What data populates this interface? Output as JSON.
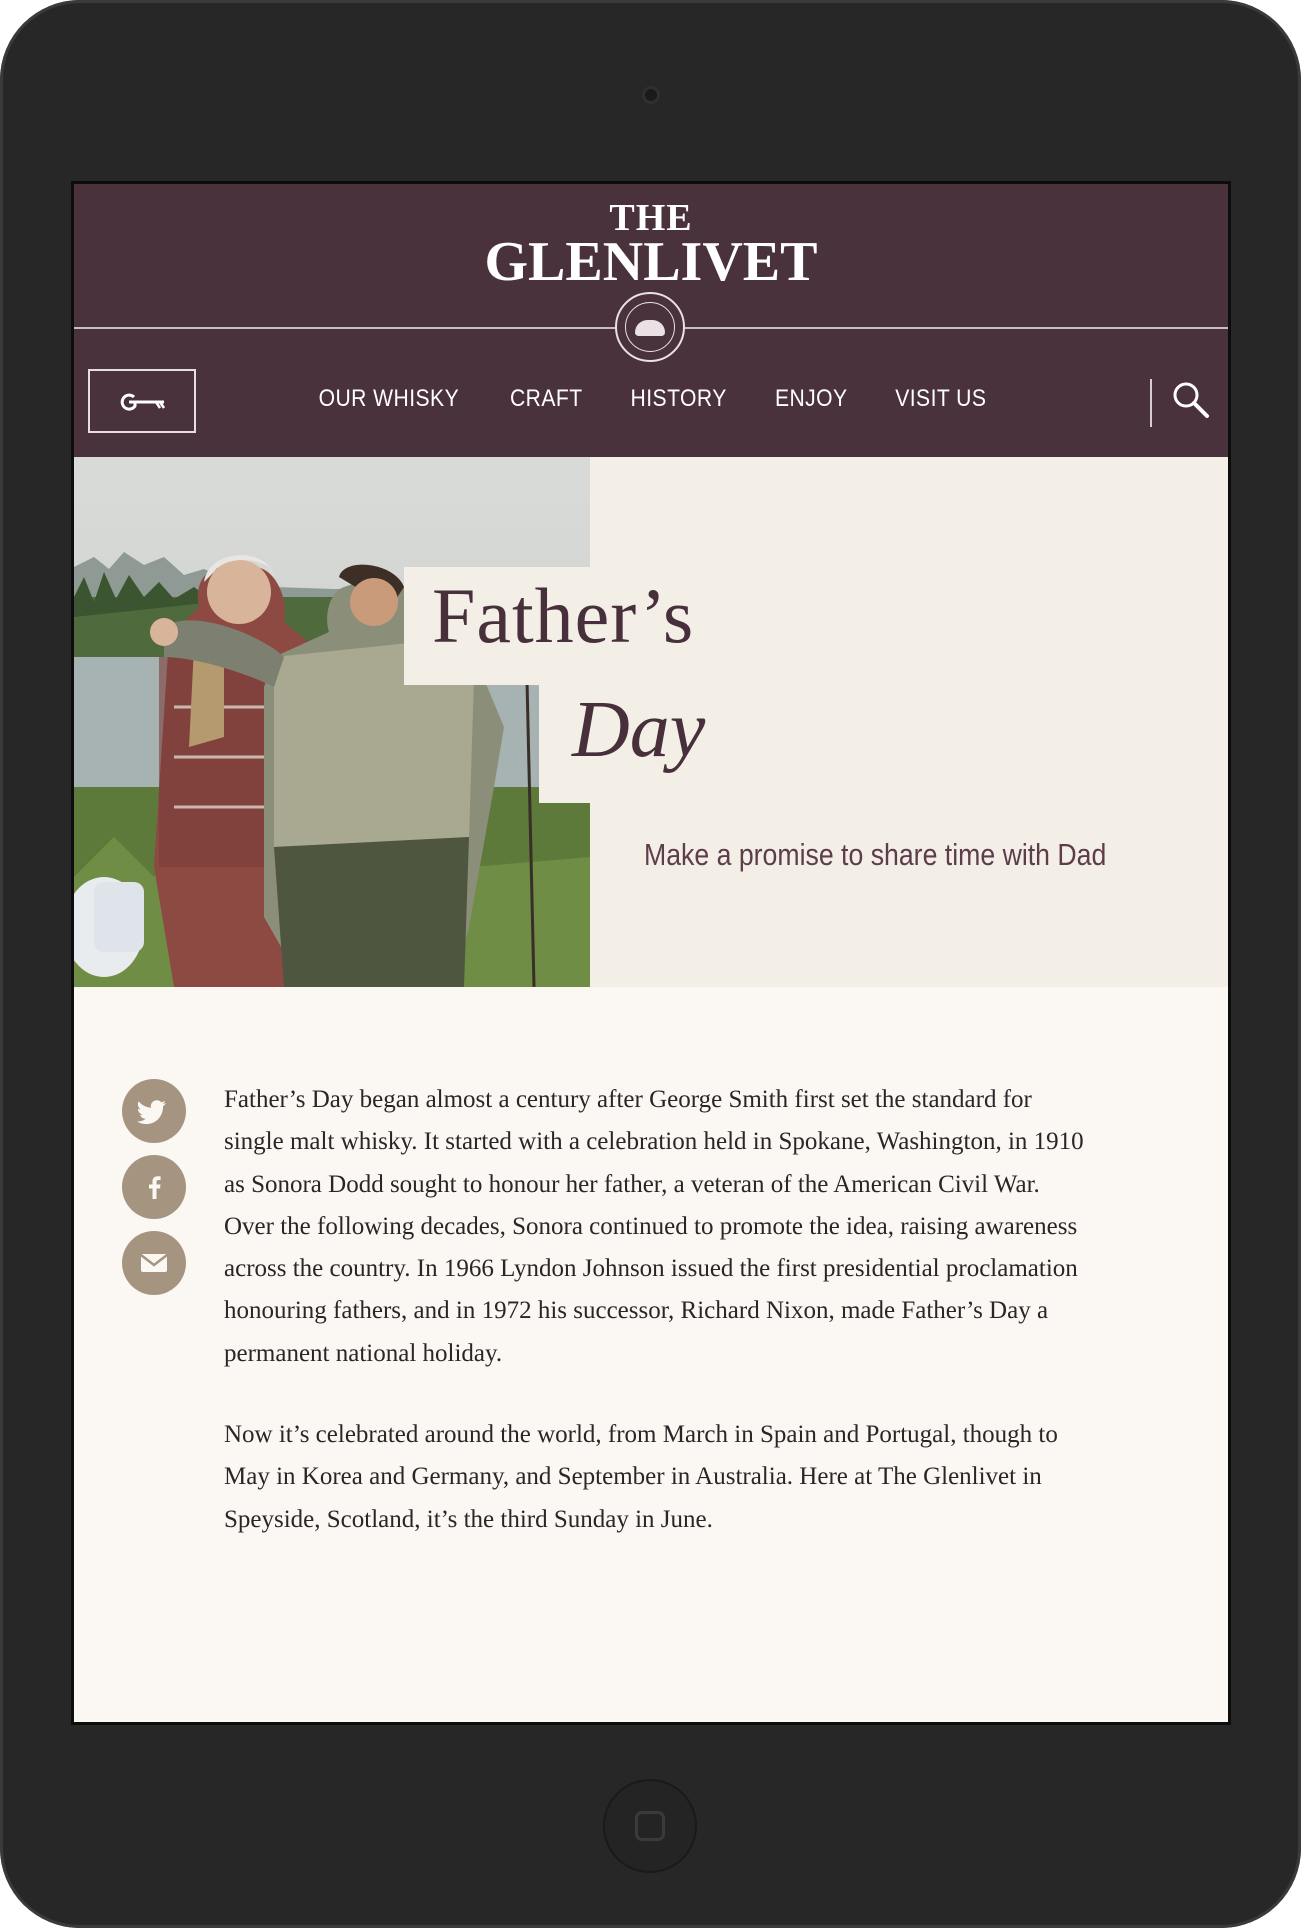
{
  "brand": {
    "line1": "THE",
    "line2": "GLENLIVET"
  },
  "nav": {
    "items": [
      "OUR WHISKY",
      "CRAFT",
      "HISTORY",
      "ENJOY",
      "VISIT US"
    ]
  },
  "hero": {
    "title_line1": "Father’s",
    "title_line2": "Day",
    "subtitle": "Make a promise to share time with Dad"
  },
  "social": {
    "icons": [
      "twitter-icon",
      "facebook-icon",
      "email-icon"
    ]
  },
  "article": {
    "paragraph1": "Father’s Day began almost a century after George Smith first set the standard for single malt whisky. It started with a celebration held in Spokane, Washington, in 1910 as Sonora Dodd sought to honour her father, a veteran of the American Civil War. Over the following decades, Sonora continued to promote the idea, raising awareness across the country. In 1966 Lyndon Johnson issued the first presidential proclamation honouring fathers, and in 1972 his successor, Richard Nixon, made Father’s Day a permanent national holiday.",
    "paragraph2": "Now it’s celebrated around the world, from March in Spain and Portugal, though to May in Korea and Germany, and September in Australia. Here at The Glenlivet in Speyside, Scotland, it’s the third Sunday in June."
  },
  "colors": {
    "header_bg": "#4a323d",
    "hero_bg": "#f3efe7",
    "body_bg": "#fbf8f3",
    "title_text": "#47303b",
    "social_bg": "#a59480"
  }
}
